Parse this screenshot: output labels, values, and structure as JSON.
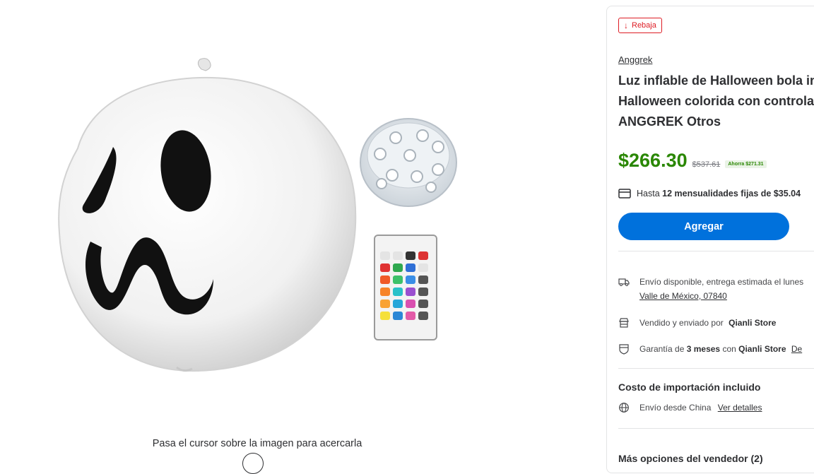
{
  "gallery": {
    "hover_hint": "Pasa el cursor sobre la imagen para acercarla"
  },
  "product": {
    "badge_label": "Rebaja",
    "brand": "Anggrek",
    "title_lines": [
      "Luz inflable de Halloween bola inf",
      "Halloween colorida con controla",
      "ANGGREK Otros"
    ],
    "price": "$266.30",
    "old_price": "$537.61",
    "savings": "Ahorra $271.31",
    "installments_prefix": "Hasta",
    "installments_bold": "12 mensualidades fijas de $35.04",
    "add_button_label": "Agregar"
  },
  "shipping": {
    "text": "Envío disponible, entrega estimada el lunes",
    "location_link": "Valle de México, 07840"
  },
  "seller": {
    "prefix": "Vendido y enviado por",
    "name": "Qianli Store"
  },
  "warranty": {
    "prefix": "Garantía de",
    "months": "3 meses",
    "middle": "con",
    "store": "Qianli Store",
    "link": "De"
  },
  "import": {
    "title": "Costo de importación incluido",
    "text": "Envío desde China",
    "link": "Ver detalles"
  },
  "more_options": "Más opciones del vendedor (2)",
  "colors": {
    "price_green": "#2a8703",
    "primary_blue": "#0071dc",
    "sale_red": "#de1c24"
  }
}
